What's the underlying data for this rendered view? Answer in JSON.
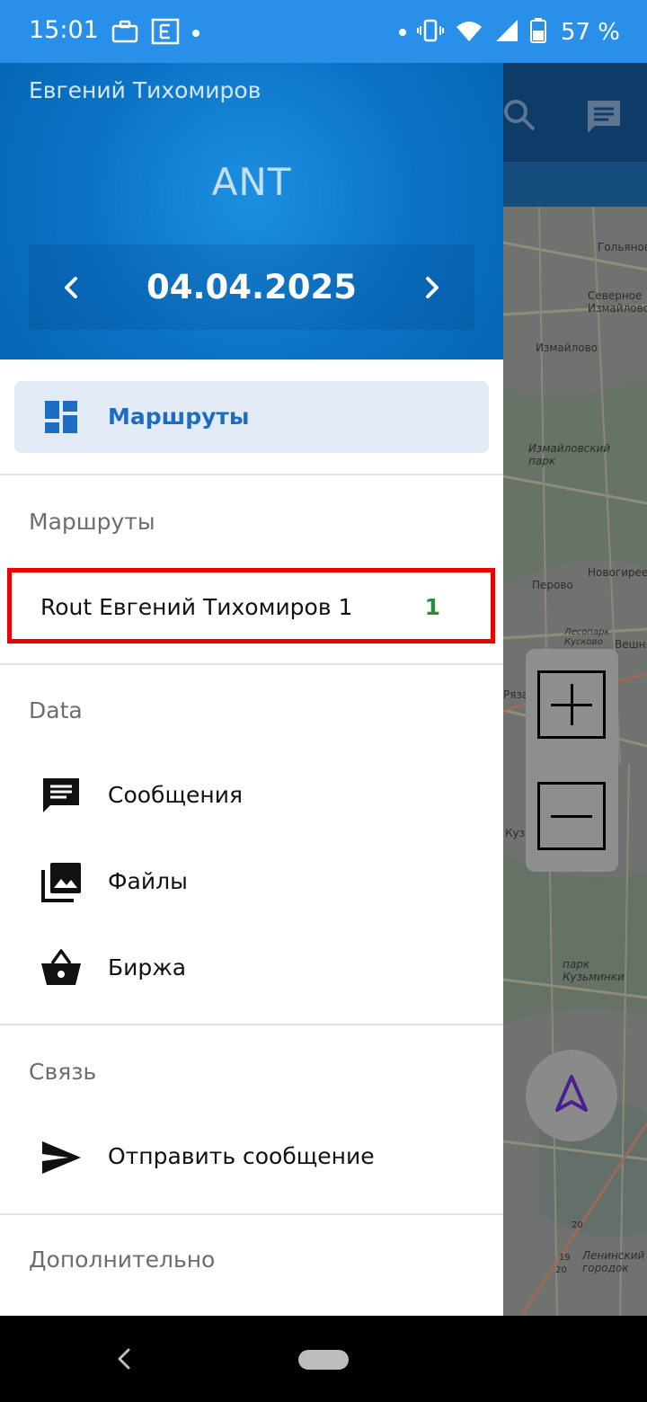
{
  "status_bar": {
    "time": "15:01",
    "battery": "57 %"
  },
  "drawer": {
    "user_name": "Евгений Тихомиров",
    "app_name": "ANT",
    "date": "04.04.2025",
    "selected_item": "Маршруты",
    "sections": {
      "routes_title": "Маршруты",
      "data_title": "Data",
      "comm_title": "Связь",
      "extra_title": "Дополнительно"
    },
    "route": {
      "name": "Rout Евгений Тихомиров 1",
      "count": "1"
    },
    "data_items": [
      {
        "label": "Сообщения",
        "icon": "message-icon"
      },
      {
        "label": "Файлы",
        "icon": "photo-library-icon"
      },
      {
        "label": "Биржа",
        "icon": "basket-icon"
      }
    ],
    "comm_items": [
      {
        "label": "Отправить сообщение",
        "icon": "send-icon"
      }
    ]
  },
  "map": {
    "labels": [
      "Гольяново",
      "Северное Измайлово",
      "Измайлово",
      "Измайловский парк",
      "Новогиреево",
      "Перово",
      "Вешняки",
      "Кузьминки",
      "парк Кузьминки",
      "Рязанский",
      "Лесопарк Кусково",
      "Ленинский городок",
      "20",
      "19",
      "20"
    ]
  },
  "colors": {
    "status_bar": "#2a8fe8",
    "drawer_header": "#0b73c7",
    "accent": "#1d6dc4",
    "highlight_border": "#ee0000",
    "count_green": "#2e8b3a"
  }
}
